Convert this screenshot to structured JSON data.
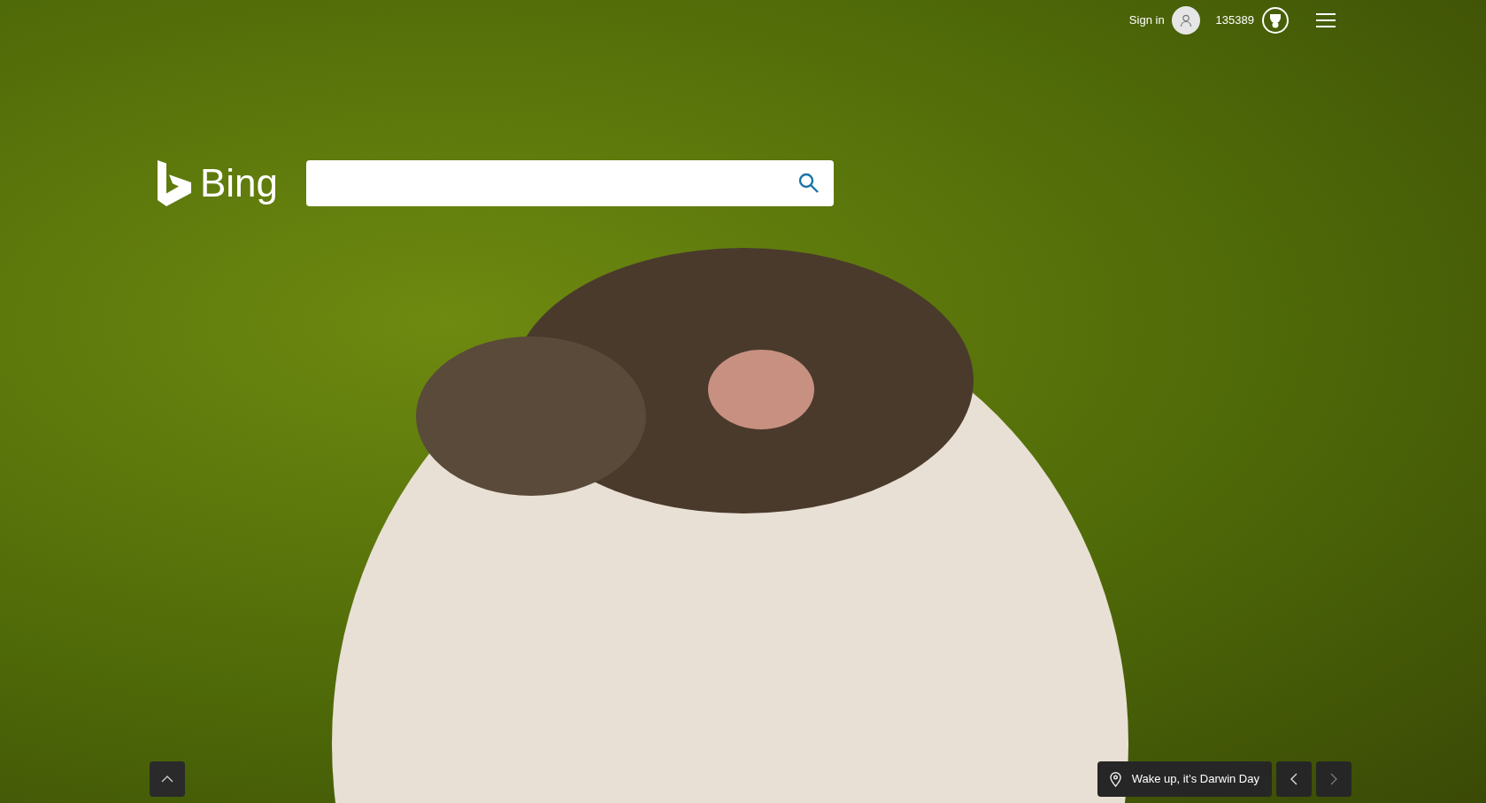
{
  "header": {
    "sign_in": "Sign in",
    "points": "135389"
  },
  "logo": {
    "text": "Bing"
  },
  "footer": {
    "location": "Wake up, it's Darwin Day",
    "previous": {
      "disabled": false
    },
    "next": {
      "disabled": true
    }
  }
}
